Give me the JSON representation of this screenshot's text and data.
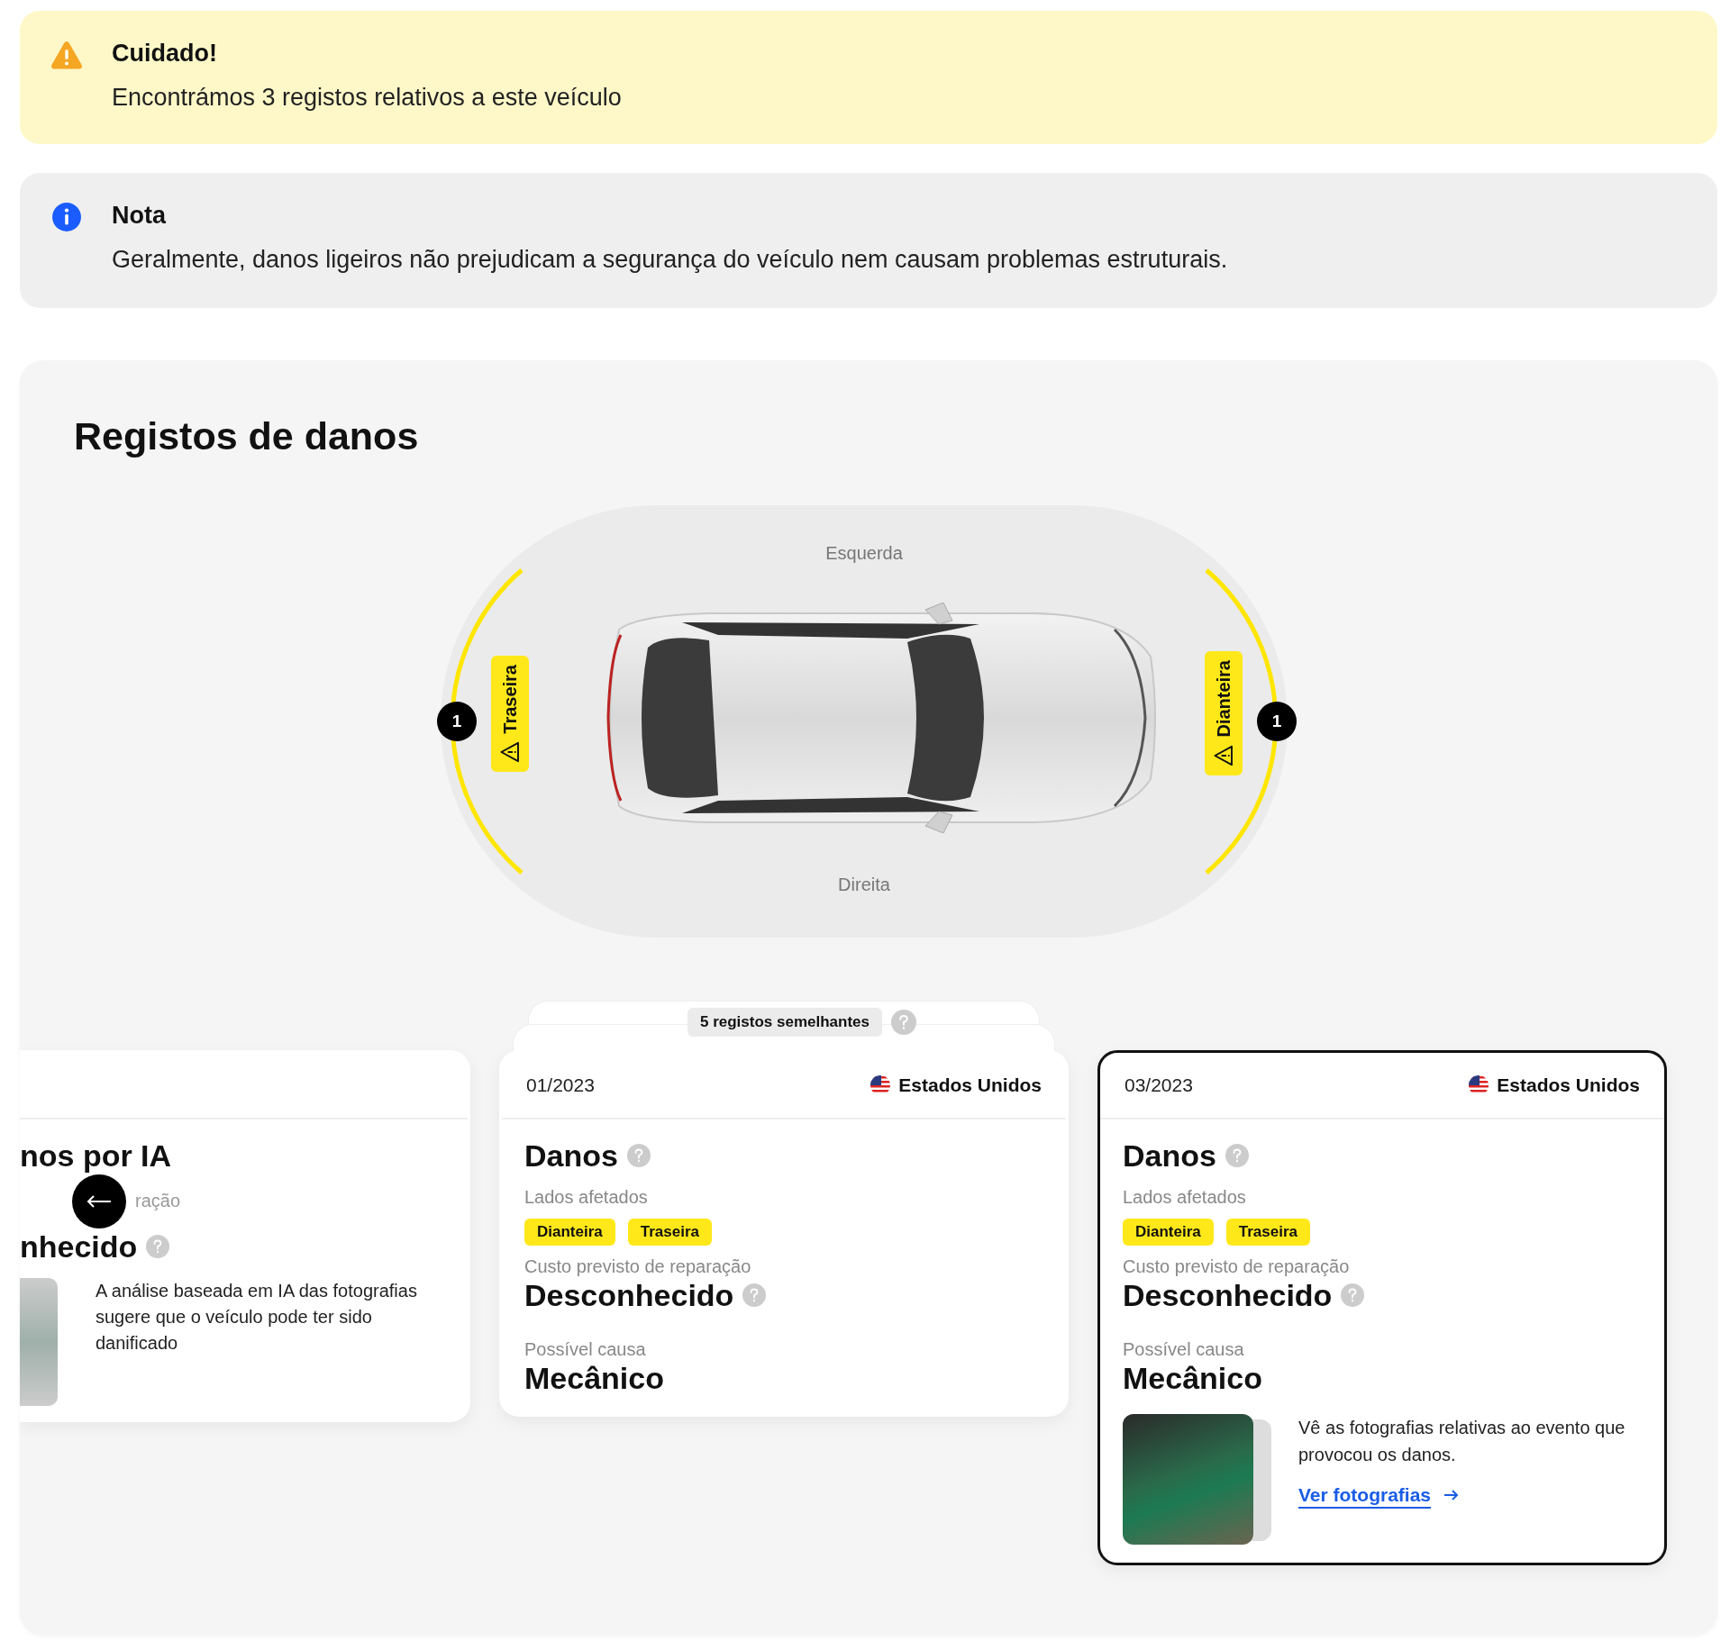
{
  "alerts": [
    {
      "kind": "warning",
      "title": "Cuidado!",
      "message": "Encontrámos 3 registos relativos a este veículo"
    },
    {
      "kind": "info",
      "title": "Nota",
      "message": "Geralmente, danos ligeiros não prejudicam a segurança do veículo nem causam problemas estruturais."
    }
  ],
  "damage_section": {
    "title": "Registos de danos",
    "diagram": {
      "top_label": "Esquerda",
      "bottom_label": "Direita",
      "zones": [
        {
          "label": "Traseira",
          "count": "1"
        },
        {
          "label": "Dianteira",
          "count": "1"
        }
      ]
    },
    "cards": [
      {
        "kind": "partial",
        "selected": false,
        "title": "nos por IA",
        "label": "ração",
        "value": "nhecido",
        "description": "A análise baseada em IA das fotografias sugere que o veículo pode ter sido danificado"
      },
      {
        "kind": "record",
        "selected": false,
        "similar_records": "5 registos semelhantes",
        "date": "01/2023",
        "country": "Estados Unidos",
        "heading": "Danos",
        "sides_label": "Lados afetados",
        "sides": [
          "Dianteira",
          "Traseira"
        ],
        "cost_label": "Custo previsto de reparação",
        "cost": "Desconhecido",
        "cause_label": "Possível causa",
        "cause": "Mecânico"
      },
      {
        "kind": "record",
        "selected": true,
        "date": "03/2023",
        "country": "Estados Unidos",
        "heading": "Danos",
        "sides_label": "Lados afetados",
        "sides": [
          "Dianteira",
          "Traseira"
        ],
        "cost_label": "Custo previsto de reparação",
        "cost": "Desconhecido",
        "cause_label": "Possível causa",
        "cause": "Mecânico",
        "photos": {
          "text": "Vê as fotografias relativas ao evento que provocou os danos.",
          "link": "Ver fotografias"
        }
      }
    ]
  }
}
